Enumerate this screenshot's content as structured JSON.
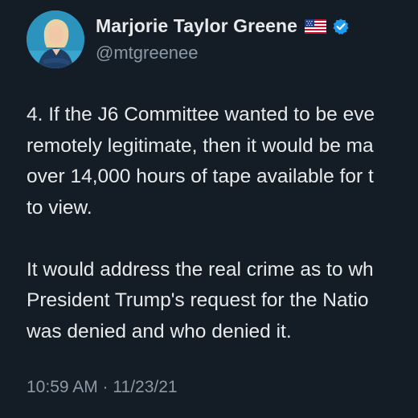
{
  "author": {
    "display_name": "Marjorie Taylor Greene",
    "handle": "@mtgreenee",
    "flag_icon": "us-flag-icon",
    "verified_icon": "verified-badge-icon",
    "verified_color": "#1d9bf0"
  },
  "tweet": {
    "paragraph1": [
      "4. If the J6 Committee wanted to be eve",
      "remotely legitimate, then it would be ma",
      "over 14,000 hours of tape available for t",
      "to view."
    ],
    "paragraph2": [
      "It would address the real crime as to wh",
      "President Trump's request for the Natio",
      "was denied and who denied it."
    ],
    "timestamp": "10:59 AM · 11/23/21"
  },
  "colors": {
    "background": "#141d26",
    "text": "#e7e9ea",
    "secondary_text": "#8b98a5"
  }
}
